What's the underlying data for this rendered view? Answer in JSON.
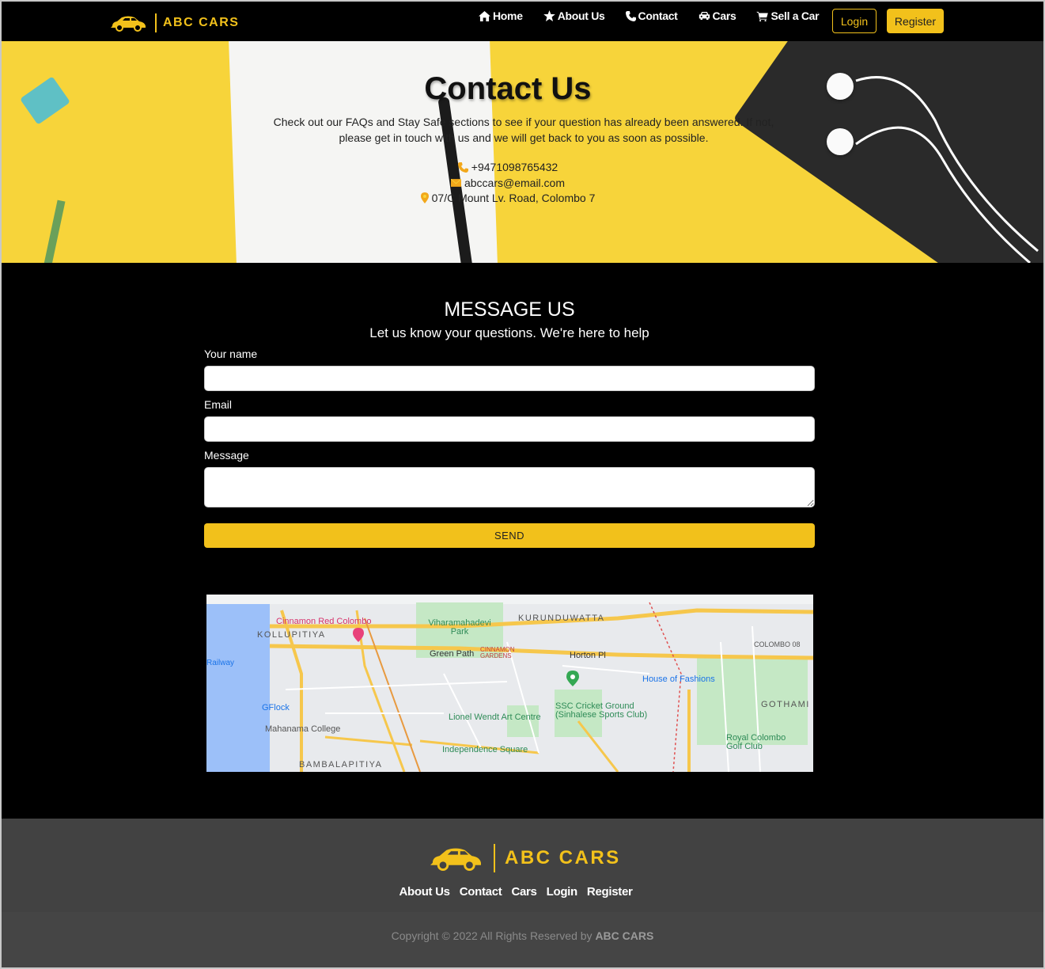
{
  "nav": {
    "brand": "ABC CARS",
    "items": [
      {
        "label": "Home",
        "icon": "home-icon"
      },
      {
        "label": "About Us",
        "icon": "star-icon"
      },
      {
        "label": "Contact",
        "icon": "phone-icon"
      },
      {
        "label": "Cars",
        "icon": "car-icon"
      },
      {
        "label": "Sell a Car",
        "icon": "cart-icon"
      }
    ],
    "login": "Login",
    "register": "Register"
  },
  "hero": {
    "title": "Contact Us",
    "description": "Check out our FAQs and Stay Safe sections to see if your question has already been answered. If not, please get in touch with us and we will get back to you as soon as possible.",
    "phone": "+9471098765432",
    "email": "abccars@email.com",
    "address": "07/C Mount Lv. Road, Colombo 7"
  },
  "form": {
    "heading": "MESSAGE US",
    "subheading": "Let us know your questions. We're here to help",
    "name_label": "Your name",
    "name_value": "",
    "email_label": "Email",
    "email_value": "",
    "message_label": "Message",
    "message_value": "",
    "send": "SEND"
  },
  "map": {
    "labels": [
      "Cinnamon Red Colombo",
      "KOLLUPITIYA",
      "Viharamahadevi Park",
      "KURUNDUWATTA",
      "Green Path",
      "CINNAMON GARDENS",
      "Horton Pl",
      "COLOMBO 08",
      "House of Fashions",
      "GOTHAMI",
      "SSC Cricket Ground (Sinhalese Sports Club)",
      "Lionel Wendt Art Centre",
      "GFlock",
      "Mahanama College",
      "Independence Square",
      "Royal Colombo Golf Club",
      "BAMBALAPITIYA",
      "Railway"
    ]
  },
  "footer": {
    "brand": "ABC CARS",
    "links": [
      "About Us",
      "Contact",
      "Cars",
      "Login",
      "Register"
    ],
    "copyright_prefix": "Copyright © 2022 All Rights Reserved by",
    "copyright_brand": "ABC CARS"
  },
  "colors": {
    "accent": "#f2c11b",
    "nav_bg": "#000000",
    "footer_bg": "#424242"
  }
}
